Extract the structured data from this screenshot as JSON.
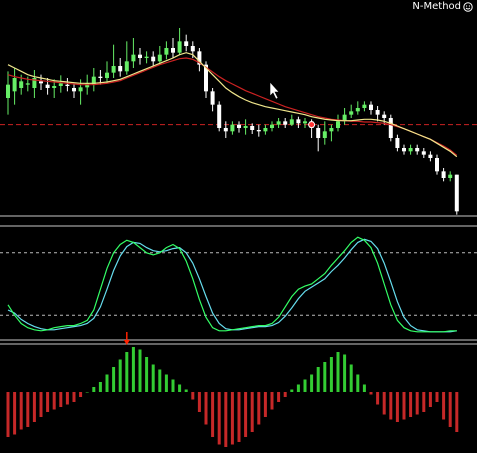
{
  "brand": {
    "label": "N-Method",
    "icon": "smiley-icon"
  },
  "colors": {
    "background": "#000000",
    "bull_candle": "#66ee66",
    "bear_candle": "#ffffff",
    "ma_fast": "#f0e68c",
    "ma_slow": "#cc2222",
    "level_line": "#cc2222",
    "separator": "#c8c8c8",
    "stoch_main": "#33ff66",
    "stoch_signal": "#66ddee",
    "stoch_levels": "#bbbbbb",
    "hist_up": "#33cc33",
    "hist_down": "#c62828",
    "arrow": "#ff2200"
  },
  "chart_data": {
    "type": "candlestick",
    "panels": [
      "price",
      "stochastic",
      "histogram"
    ],
    "candles": [
      [
        0.4,
        0.6,
        0.15,
        0.8
      ],
      [
        0.5,
        0.7,
        0.3,
        0.85
      ],
      [
        0.55,
        0.65,
        0.45,
        0.75
      ],
      [
        0.6,
        0.62,
        0.5,
        0.72
      ],
      [
        0.55,
        0.7,
        0.4,
        0.82
      ],
      [
        0.65,
        0.62,
        0.52,
        0.75
      ],
      [
        0.6,
        0.55,
        0.45,
        0.7
      ],
      [
        0.55,
        0.58,
        0.4,
        0.68
      ],
      [
        0.58,
        0.62,
        0.48,
        0.74
      ],
      [
        0.6,
        0.58,
        0.5,
        0.7
      ],
      [
        0.55,
        0.5,
        0.4,
        0.62
      ],
      [
        0.5,
        0.56,
        0.3,
        0.68
      ],
      [
        0.56,
        0.62,
        0.45,
        0.75
      ],
      [
        0.6,
        0.72,
        0.5,
        0.85
      ],
      [
        0.72,
        0.7,
        0.6,
        0.82
      ],
      [
        0.7,
        0.78,
        0.62,
        0.95
      ],
      [
        0.78,
        0.88,
        0.7,
        1.2
      ],
      [
        0.88,
        0.8,
        0.72,
        1.0
      ],
      [
        0.8,
        0.95,
        0.75,
        1.25
      ],
      [
        0.95,
        1.05,
        0.85,
        1.3
      ],
      [
        1.05,
        1.0,
        0.9,
        1.15
      ],
      [
        1.0,
        1.02,
        0.92,
        1.1
      ],
      [
        1.02,
        0.95,
        0.88,
        1.1
      ],
      [
        0.95,
        1.05,
        0.9,
        1.18
      ],
      [
        1.05,
        1.15,
        0.98,
        1.25
      ],
      [
        1.15,
        1.08,
        1.0,
        1.3
      ],
      [
        1.08,
        1.25,
        1.05,
        1.45
      ],
      [
        1.25,
        1.18,
        1.1,
        1.35
      ],
      [
        1.18,
        1.1,
        1.0,
        1.25
      ],
      [
        1.1,
        0.9,
        0.8,
        1.15
      ],
      [
        0.9,
        0.5,
        0.4,
        0.95
      ],
      [
        0.5,
        0.3,
        0.2,
        0.55
      ],
      [
        0.3,
        -0.05,
        -0.1,
        0.35
      ],
      [
        -0.05,
        -0.1,
        -0.2,
        0.05
      ],
      [
        -0.1,
        0.0,
        -0.15,
        0.05
      ],
      [
        0.0,
        -0.05,
        -0.12,
        0.05
      ],
      [
        -0.05,
        -0.02,
        -0.15,
        0.08
      ],
      [
        -0.02,
        -0.08,
        -0.14,
        0.02
      ],
      [
        -0.08,
        -0.1,
        -0.18,
        0.0
      ],
      [
        -0.1,
        -0.05,
        -0.15,
        0.0
      ],
      [
        -0.05,
        0.0,
        -0.1,
        0.05
      ],
      [
        0.0,
        0.05,
        -0.05,
        0.1
      ],
      [
        0.05,
        0.0,
        -0.05,
        0.1
      ],
      [
        0.0,
        0.08,
        -0.02,
        0.15
      ],
      [
        0.08,
        0.02,
        -0.05,
        0.12
      ],
      [
        0.02,
        0.05,
        -0.05,
        0.1
      ],
      [
        0.05,
        -0.05,
        -0.2,
        0.08
      ],
      [
        -0.05,
        -0.2,
        -0.4,
        0.0
      ],
      [
        -0.2,
        -0.1,
        -0.3,
        0.05
      ],
      [
        -0.1,
        -0.05,
        -0.25,
        0.0
      ],
      [
        -0.05,
        0.05,
        -0.1,
        0.15
      ],
      [
        0.05,
        0.15,
        0.0,
        0.25
      ],
      [
        0.15,
        0.2,
        0.1,
        0.3
      ],
      [
        0.2,
        0.25,
        0.15,
        0.35
      ],
      [
        0.25,
        0.3,
        0.2,
        0.35
      ],
      [
        0.3,
        0.22,
        0.15,
        0.35
      ],
      [
        0.22,
        0.15,
        0.05,
        0.28
      ],
      [
        0.15,
        0.1,
        0.0,
        0.2
      ],
      [
        0.1,
        -0.2,
        -0.25,
        0.15
      ],
      [
        -0.2,
        -0.35,
        -0.4,
        -0.15
      ],
      [
        -0.35,
        -0.4,
        -0.45,
        -0.3
      ],
      [
        -0.4,
        -0.35,
        -0.45,
        -0.3
      ],
      [
        -0.35,
        -0.4,
        -0.45,
        -0.3
      ],
      [
        -0.4,
        -0.45,
        -0.5,
        -0.35
      ],
      [
        -0.45,
        -0.5,
        -0.55,
        -0.4
      ],
      [
        -0.5,
        -0.7,
        -0.75,
        -0.45
      ],
      [
        -0.7,
        -0.8,
        -0.85,
        -0.65
      ],
      [
        -0.8,
        -0.75,
        -0.85,
        -0.7
      ],
      [
        -0.75,
        -1.3,
        -1.35,
        -0.75
      ]
    ],
    "ma_fast": [
      0.9,
      0.85,
      0.8,
      0.75,
      0.72,
      0.7,
      0.68,
      0.66,
      0.65,
      0.64,
      0.63,
      0.62,
      0.62,
      0.62,
      0.63,
      0.64,
      0.66,
      0.68,
      0.72,
      0.76,
      0.8,
      0.84,
      0.88,
      0.92,
      0.96,
      1.0,
      1.05,
      1.08,
      1.05,
      0.95,
      0.85,
      0.75,
      0.65,
      0.55,
      0.48,
      0.42,
      0.37,
      0.33,
      0.3,
      0.27,
      0.25,
      0.23,
      0.21,
      0.19,
      0.17,
      0.15,
      0.12,
      0.1,
      0.08,
      0.07,
      0.06,
      0.06,
      0.06,
      0.07,
      0.08,
      0.08,
      0.07,
      0.05,
      0.02,
      -0.02,
      -0.06,
      -0.1,
      -0.14,
      -0.18,
      -0.22,
      -0.28,
      -0.34,
      -0.4,
      -0.48
    ],
    "ma_slow": [
      0.75,
      0.72,
      0.7,
      0.68,
      0.67,
      0.66,
      0.65,
      0.64,
      0.63,
      0.62,
      0.61,
      0.6,
      0.6,
      0.6,
      0.61,
      0.62,
      0.64,
      0.66,
      0.7,
      0.74,
      0.78,
      0.82,
      0.86,
      0.9,
      0.93,
      0.96,
      0.99,
      1.0,
      0.98,
      0.93,
      0.86,
      0.79,
      0.72,
      0.66,
      0.61,
      0.56,
      0.51,
      0.47,
      0.43,
      0.39,
      0.35,
      0.31,
      0.27,
      0.24,
      0.21,
      0.18,
      0.15,
      0.12,
      0.1,
      0.08,
      0.07,
      0.06,
      0.05,
      0.05,
      0.04,
      0.04,
      0.03,
      0.02,
      0.0,
      -0.03,
      -0.06,
      -0.1,
      -0.14,
      -0.18,
      -0.22,
      -0.27,
      -0.32,
      -0.38,
      -0.46
    ],
    "level": 0.0,
    "marker_index": 46,
    "stoch_main": [
      30,
      20,
      12,
      8,
      6,
      5,
      6,
      8,
      9,
      10,
      10,
      12,
      15,
      25,
      45,
      65,
      80,
      88,
      92,
      90,
      85,
      80,
      78,
      80,
      85,
      88,
      84,
      72,
      55,
      35,
      18,
      8,
      5,
      5,
      6,
      7,
      8,
      9,
      10,
      10,
      12,
      18,
      28,
      38,
      45,
      48,
      50,
      55,
      60,
      68,
      75,
      82,
      90,
      95,
      92,
      85,
      70,
      50,
      30,
      15,
      8,
      5,
      4,
      4,
      4,
      4,
      4,
      5,
      5
    ],
    "stoch_signal": [
      25,
      22,
      16,
      12,
      9,
      7,
      6,
      6,
      7,
      8,
      9,
      10,
      12,
      17,
      28,
      45,
      63,
      77,
      86,
      90,
      89,
      85,
      82,
      81,
      82,
      84,
      85,
      80,
      70,
      55,
      38,
      22,
      12,
      7,
      6,
      6,
      7,
      8,
      9,
      9,
      10,
      13,
      19,
      27,
      36,
      43,
      47,
      51,
      55,
      62,
      68,
      75,
      83,
      90,
      93,
      91,
      84,
      70,
      52,
      33,
      18,
      10,
      6,
      5,
      4,
      4,
      4,
      4,
      5
    ],
    "stoch_levels": [
      80,
      20
    ],
    "histogram": [
      -0.9,
      -0.85,
      -0.75,
      -0.7,
      -0.6,
      -0.5,
      -0.4,
      -0.35,
      -0.3,
      -0.25,
      -0.2,
      -0.1,
      0.0,
      0.1,
      0.2,
      0.35,
      0.5,
      0.65,
      0.8,
      0.9,
      0.85,
      0.7,
      0.55,
      0.45,
      0.35,
      0.25,
      0.15,
      0.05,
      -0.15,
      -0.4,
      -0.65,
      -0.9,
      -1.05,
      -1.1,
      -1.05,
      -1.0,
      -0.9,
      -0.8,
      -0.65,
      -0.5,
      -0.35,
      -0.2,
      -0.1,
      0.05,
      0.15,
      0.25,
      0.35,
      0.5,
      0.6,
      0.7,
      0.8,
      0.75,
      0.55,
      0.35,
      0.15,
      -0.05,
      -0.25,
      -0.45,
      -0.55,
      -0.6,
      -0.55,
      -0.5,
      -0.45,
      -0.4,
      -0.3,
      -0.2,
      -0.55,
      -0.7,
      -0.8
    ],
    "arrow_index": 18
  }
}
